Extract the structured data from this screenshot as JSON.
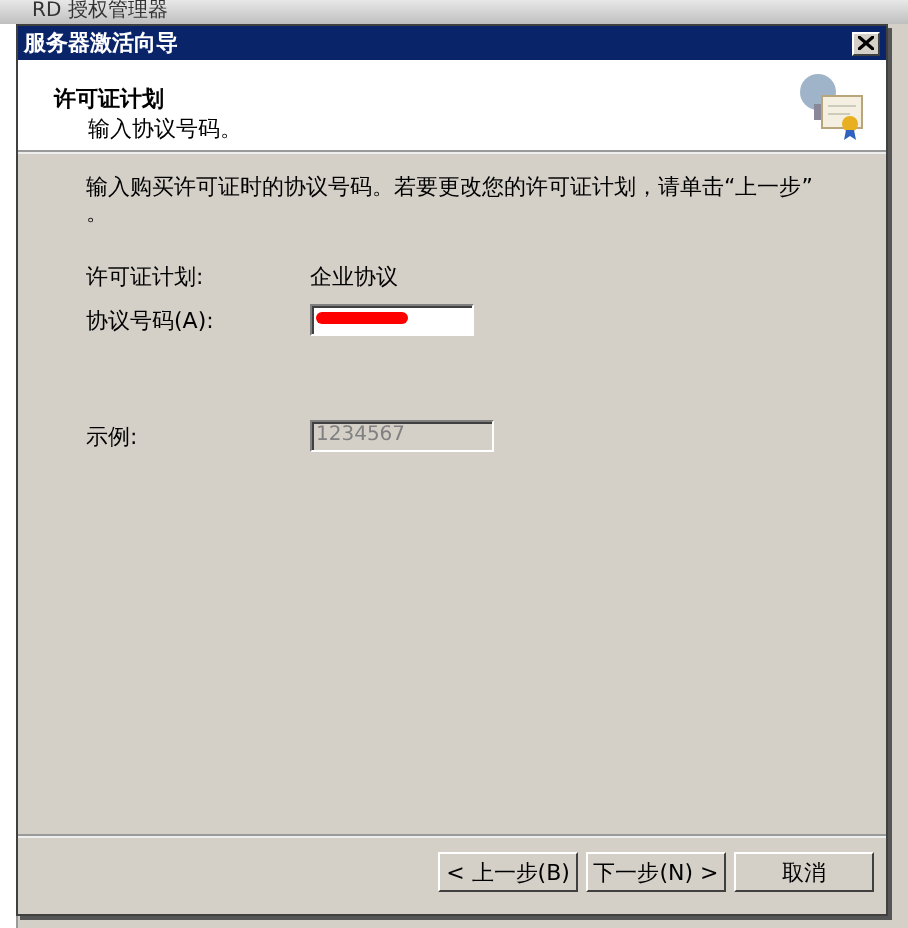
{
  "background_window": {
    "title": "RD 授权管理器"
  },
  "window": {
    "title": "服务器激活向导"
  },
  "header": {
    "title": "许可证计划",
    "subtitle": "输入协议号码。"
  },
  "instructions": "输入购买许可证时的协议号码。若要更改您的许可证计划，请单击“上一步”\n。",
  "fields": [
    {
      "kind": "text",
      "label": "许可证计划:",
      "value": "企业协议"
    },
    {
      "kind": "input",
      "label": "协议号码(A):",
      "redacted": true
    },
    {
      "kind": "spacer"
    },
    {
      "kind": "disabled_input",
      "label": "示例:",
      "value": "1234567"
    }
  ],
  "buttons": [
    {
      "label": "< 上一步(B)"
    },
    {
      "label": "下一步(N) >"
    },
    {
      "label": "取消"
    }
  ]
}
